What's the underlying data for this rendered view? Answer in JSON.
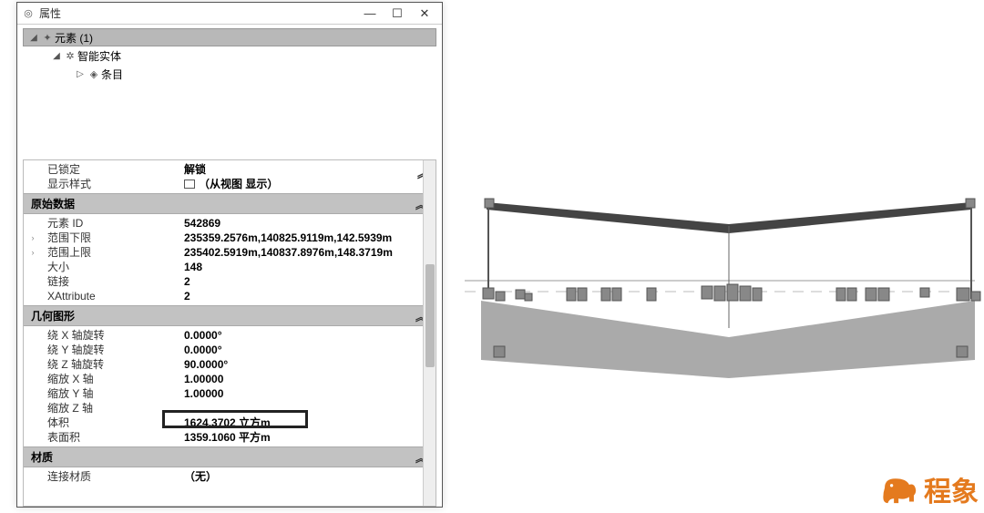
{
  "window": {
    "title": "属性",
    "minimize": "—",
    "maximize": "☐",
    "close": "✕"
  },
  "tree": {
    "root": "元素 (1)",
    "child1": "智能实体",
    "child2": "条目"
  },
  "section_top": {
    "locked_label": "已锁定",
    "locked_value": "解锁",
    "display_label": "显示样式",
    "display_value": "（从视图 显示）",
    "collapse": "︽"
  },
  "section_raw": {
    "header": "原始数据",
    "rows": [
      {
        "k": "元素 ID",
        "v": "542869"
      },
      {
        "k": "范围下限",
        "v": "235359.2576m,140825.9119m,142.5939m"
      },
      {
        "k": "范围上限",
        "v": "235402.5919m,140837.8976m,148.3719m"
      },
      {
        "k": "大小",
        "v": "148"
      },
      {
        "k": "链接",
        "v": "2"
      },
      {
        "k": "XAttribute",
        "v": "2"
      }
    ]
  },
  "section_geom": {
    "header": "几何图形",
    "rows": [
      {
        "k": "绕 X 轴旋转",
        "v": "0.0000°"
      },
      {
        "k": "绕 Y 轴旋转",
        "v": "0.0000°"
      },
      {
        "k": "绕 Z 轴旋转",
        "v": "90.0000°"
      },
      {
        "k": "缩放 X 轴",
        "v": "1.00000"
      },
      {
        "k": "缩放 Y 轴",
        "v": "1.00000"
      },
      {
        "k": "缩放 Z 轴",
        "v": ""
      },
      {
        "k": "体积",
        "v": "1624.3702 立方m"
      },
      {
        "k": "表面积",
        "v": "1359.1060 平方m"
      }
    ]
  },
  "section_mat": {
    "header": "材质",
    "rows": [
      {
        "k": "连接材质",
        "v": "（无）"
      }
    ]
  },
  "logo_text": "程象"
}
